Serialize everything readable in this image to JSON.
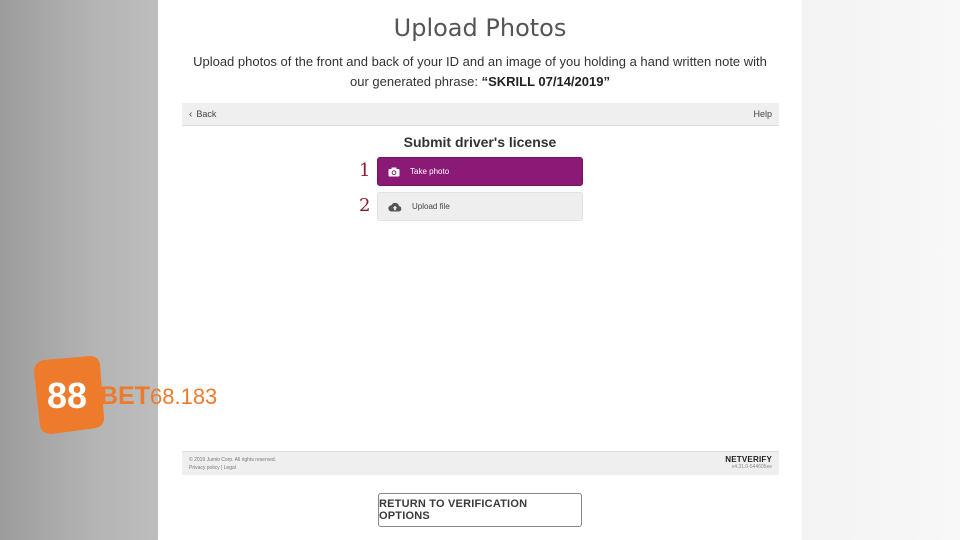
{
  "header": {
    "title": "Upload Photos",
    "instructions_prefix": "Upload photos of the front and back of your ID and an image of you holding a hand written note with our generated phrase:",
    "phrase": "“SKRILL 07/14/2019”"
  },
  "topbar": {
    "back_label": "Back",
    "help_label": "Help"
  },
  "main": {
    "section_title": "Submit driver's license",
    "steps": [
      {
        "number": "1",
        "label": "Take photo",
        "icon": "camera-icon"
      },
      {
        "number": "2",
        "label": "Upload file",
        "icon": "cloud-upload-icon"
      }
    ]
  },
  "footer": {
    "copyright": "© 2019 Jumio Corp. All rights reserved.",
    "links": "Privacy policy | Legal",
    "brand": "NETVERIFY",
    "version": "v4.31.0-544605ee"
  },
  "return_button": "RETURN TO VERIFICATION OPTIONS",
  "watermark": {
    "badge": "88",
    "brand": "BET",
    "suffix": "68.183"
  },
  "colors": {
    "primary": "#8a1a76",
    "step_number": "#8a1d2c",
    "watermark": "#ee7b2c"
  }
}
